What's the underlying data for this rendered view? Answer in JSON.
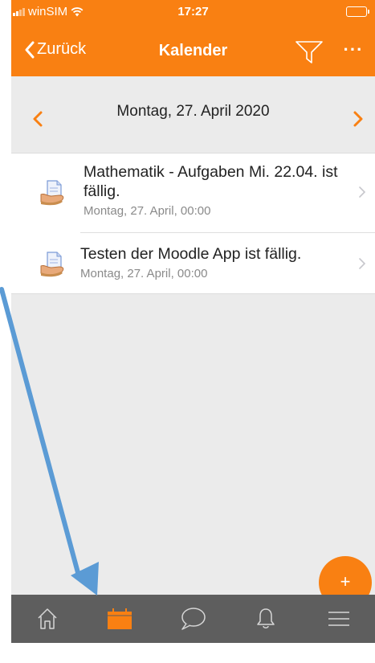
{
  "status_bar": {
    "carrier": "winSIM",
    "time": "17:27"
  },
  "header": {
    "back_label": "Zurück",
    "title": "Kalender"
  },
  "day_nav": {
    "date": "Montag, 27. April 2020"
  },
  "events": [
    {
      "name": "Mathematik - Aufgaben Mi. 22.04. ist fällig.",
      "when": "Montag, 27. April, 00:00"
    },
    {
      "name": "Testen der Moodle App ist fällig.",
      "when": "Montag, 27. April, 00:00"
    }
  ],
  "fab": {
    "label": "+"
  },
  "tabbar": {
    "tabs": [
      {
        "icon": "home-icon",
        "active": false
      },
      {
        "icon": "calendar-icon",
        "active": true
      },
      {
        "icon": "chat-bubble-icon",
        "active": false
      },
      {
        "icon": "bell-icon",
        "active": false
      },
      {
        "icon": "menu-icon",
        "active": false
      }
    ]
  },
  "colors": {
    "brand": "#f98012",
    "background": "#ebebeb",
    "tabbar": "#5e5e5e",
    "annotation_arrow": "#5b9bd5"
  }
}
